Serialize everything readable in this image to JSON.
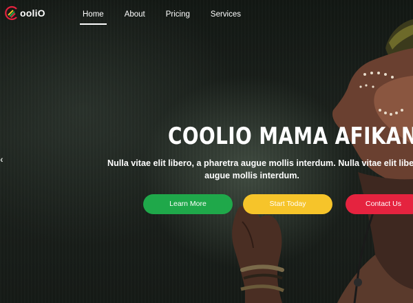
{
  "brand": {
    "name": "ooliO"
  },
  "nav": {
    "items": [
      {
        "label": "Home",
        "active": true
      },
      {
        "label": "About",
        "active": false
      },
      {
        "label": "Pricing",
        "active": false
      },
      {
        "label": "Services",
        "active": false
      }
    ]
  },
  "hero": {
    "headline": "COOLIO MAMA AFIKANA",
    "subtitle_line1": "Nulla vitae elit libero, a pharetra augue mollis interdum. Nulla vitae elit libero, a",
    "subtitle_line2": "augue mollis interdum.",
    "buttons": {
      "learn_more": "Learn More",
      "start_today": "Start Today",
      "contact_us": "Contact Us"
    },
    "prev_arrow_icon": "chevron-left-icon"
  },
  "colors": {
    "green": "#1fa84a",
    "yellow": "#f6c42a",
    "red": "#e5233f",
    "background": "#151a16"
  }
}
